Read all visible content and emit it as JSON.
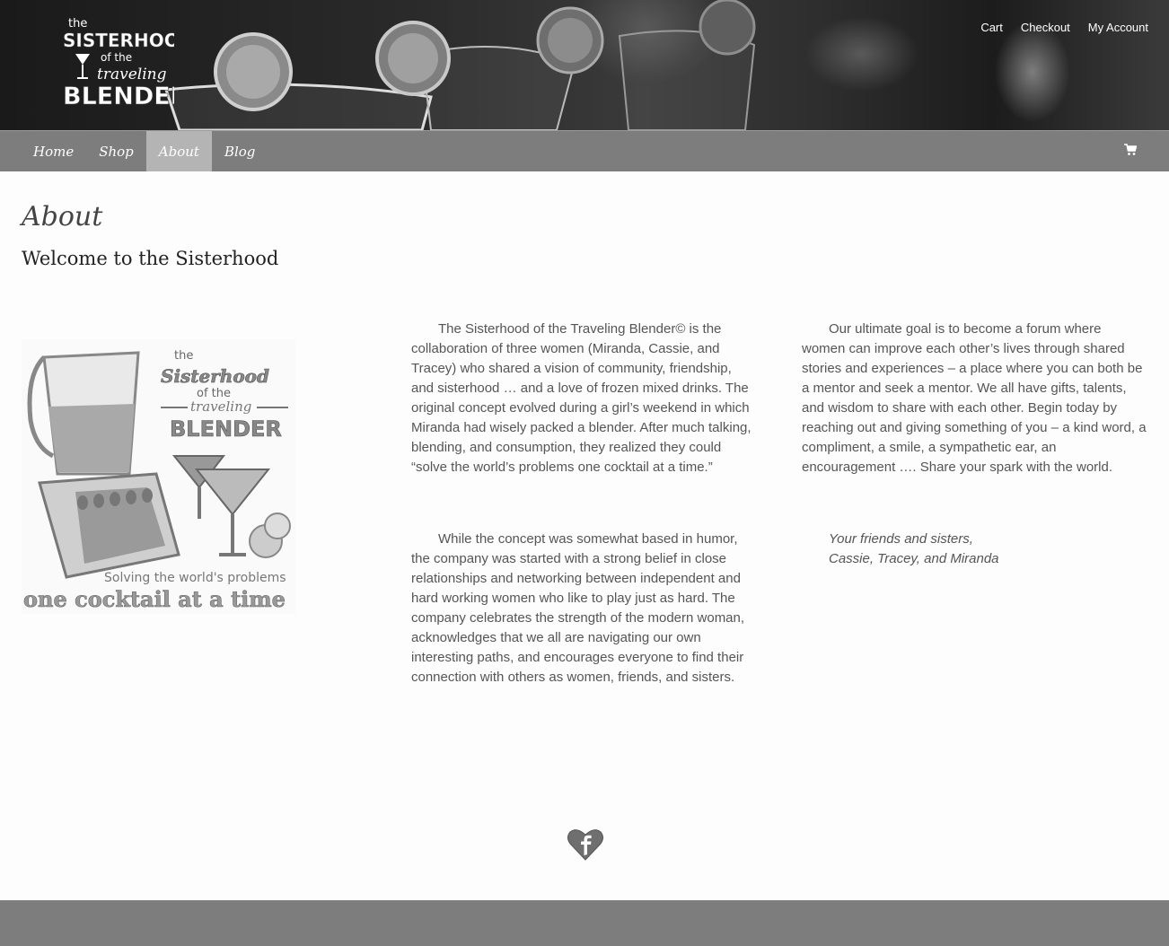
{
  "header": {
    "logo_text": [
      "the",
      "SISTERHOOD",
      "of the",
      "traveling",
      "BLENDER"
    ],
    "top_links": [
      "Cart",
      "Checkout",
      "My Account"
    ]
  },
  "nav": {
    "items": [
      {
        "label": "Home",
        "active": false
      },
      {
        "label": "Shop",
        "active": false
      },
      {
        "label": "About",
        "active": true
      },
      {
        "label": "Blog",
        "active": false
      }
    ],
    "cart_icon": "shopping-cart-icon"
  },
  "page": {
    "title": "About",
    "subtitle": "Welcome to the Sisterhood"
  },
  "graphic": {
    "text": [
      "the",
      "Sisterhood",
      "of the",
      "traveling",
      "BLENDER",
      "Solving the world's problems",
      "one cocktail at a time"
    ]
  },
  "content": {
    "col1_p1": "The Sisterhood of the Traveling Blender© is the collaboration of three women (Miranda, Cassie, and Tracey) who shared a vision of community, friendship, and sisterhood … and a love of frozen mixed drinks. The original concept evolved during a girl’s weekend in which Miranda had wisely packed a blender. After much talking, blending, and consumption, they realized they could “solve the world’s problems one cocktail at a time.”",
    "col1_p2": "While the concept was somewhat based in humor, the company was started with a strong belief in close relationships and networking between independent and hard working women who like to play just as hard. The company celebrates the strength of the modern woman, acknowledges that we all are navigating our own interesting paths, and encourages everyone to find their connection with others as women, friends, and sisters.",
    "col2_p1": "Our ultimate goal is to become a forum where women can improve each other’s lives through shared stories and experiences – a place where you can both be a mentor and seek a mentor. We all have gifts, talents, and wisdom to share with each other. Begin today by reaching out and giving something of you – a kind word, a compliment, a smile, a sympathetic ear, an encouragement …. Share your spark with the world.",
    "signoff_line1": "Your friends and sisters,",
    "signoff_line2": "Cassie, Tracey, and Miranda"
  },
  "social": {
    "facebook_icon": "facebook-heart-icon"
  }
}
